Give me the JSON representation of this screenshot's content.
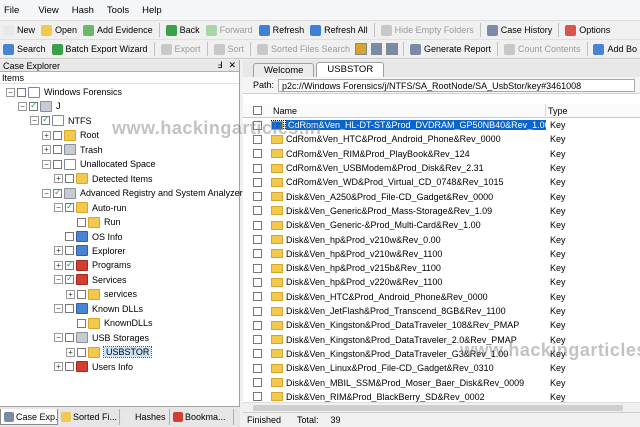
{
  "menubar": [
    "File",
    "View",
    "Hash",
    "Tools",
    "Help"
  ],
  "toolbar1": [
    {
      "label": "New",
      "icon": "new-icon",
      "color": "#e8e8ea",
      "disabled": false
    },
    {
      "label": "Open",
      "icon": "open-folder-icon",
      "color": "#f2c94c",
      "disabled": false
    },
    {
      "label": "Add Evidence",
      "icon": "add-evidence-icon",
      "color": "#6cb86a",
      "disabled": false
    },
    {
      "label": "Back",
      "icon": "back-arrow-icon",
      "color": "#3aa04a",
      "disabled": false
    },
    {
      "label": "Forward",
      "icon": "forward-arrow-icon",
      "color": "#a8d5a8",
      "disabled": true
    },
    {
      "label": "Refresh",
      "icon": "refresh-icon",
      "color": "#3f7fd8",
      "disabled": false
    },
    {
      "label": "Refresh All",
      "icon": "refresh-all-icon",
      "color": "#3f7fd8",
      "disabled": false
    },
    {
      "label": "Hide Empty Folders",
      "icon": "hide-folders-icon",
      "color": "#c8c8c8",
      "disabled": true
    },
    {
      "label": "Case History",
      "icon": "case-history-icon",
      "color": "#7a8aa8",
      "disabled": false
    },
    {
      "label": "Options",
      "icon": "options-gear-icon",
      "color": "#d9534f",
      "disabled": false
    }
  ],
  "toolbar2": [
    {
      "label": "Search",
      "icon": "search-icon",
      "color": "#4a82d4",
      "disabled": false
    },
    {
      "label": "Batch Export Wizard",
      "icon": "batch-export-icon",
      "color": "#3aa04a",
      "disabled": false
    },
    {
      "label": "Export",
      "icon": "export-icon",
      "color": "#c8c8c8",
      "disabled": true
    },
    {
      "label": "Sort",
      "icon": "sort-icon",
      "color": "#c8c8c8",
      "disabled": true
    },
    {
      "label": "Sorted Files Search",
      "icon": "sorted-search-icon",
      "color": "#c8c8c8",
      "disabled": true
    },
    {
      "label": "Generate Report",
      "icon": "report-icon",
      "color": "#7a8aa8",
      "disabled": false
    },
    {
      "label": "Count Contents",
      "icon": "count-contents-icon",
      "color": "#c8c8c8",
      "disabled": true
    },
    {
      "label": "Add Bo",
      "icon": "add-bookmark-icon",
      "color": "#4a82d4",
      "disabled": false
    }
  ],
  "left_pane": {
    "title": "Case Explorer",
    "pin": "Ⅎ",
    "close": "✕",
    "items_label": "Items",
    "tree": [
      {
        "label": "Windows Forensics",
        "level": 0,
        "icon": "case-icon",
        "expander": "−",
        "checkbox": true,
        "checked": false
      },
      {
        "label": "J",
        "level": 1,
        "icon": "drive-icon",
        "expander": "−",
        "checkbox": true,
        "checked": true
      },
      {
        "label": "NTFS",
        "level": 2,
        "icon": "ntfs-icon",
        "expander": "−",
        "checkbox": true,
        "checked": true
      },
      {
        "label": "Root",
        "level": 3,
        "icon": "folder-icon",
        "expander": "+",
        "checkbox": true,
        "checked": false
      },
      {
        "label": "Trash",
        "level": 3,
        "icon": "trash-icon",
        "expander": "+",
        "checkbox": true,
        "checked": false
      },
      {
        "label": "Unallocated Space",
        "level": 3,
        "icon": "unallocated-icon",
        "expander": "−",
        "checkbox": true,
        "checked": false
      },
      {
        "label": "Detected Items",
        "level": 4,
        "icon": "detected-icon",
        "expander": "+",
        "checkbox": true,
        "checked": false
      },
      {
        "label": "Advanced Registry and System Analyzer",
        "level": 3,
        "icon": "registry-icon",
        "expander": "−",
        "checkbox": true,
        "checked": true
      },
      {
        "label": "Auto-run",
        "level": 4,
        "icon": "autorun-icon",
        "expander": "−",
        "checkbox": true,
        "checked": true
      },
      {
        "label": "Run",
        "level": 5,
        "icon": "folder-icon",
        "expander": "",
        "checkbox": true,
        "checked": false
      },
      {
        "label": "OS Info",
        "level": 4,
        "icon": "os-info-icon",
        "expander": "",
        "checkbox": true,
        "checked": false
      },
      {
        "label": "Explorer",
        "level": 4,
        "icon": "explorer-icon",
        "expander": "+",
        "checkbox": true,
        "checked": false
      },
      {
        "label": "Programs",
        "level": 4,
        "icon": "programs-icon",
        "expander": "+",
        "checkbox": true,
        "checked": true
      },
      {
        "label": "Services",
        "level": 4,
        "icon": "services-icon",
        "expander": "−",
        "checkbox": true,
        "checked": true
      },
      {
        "label": "services",
        "level": 5,
        "icon": "folder-icon",
        "expander": "+",
        "checkbox": true,
        "checked": false
      },
      {
        "label": "Known DLLs",
        "level": 4,
        "icon": "known-dlls-icon",
        "expander": "−",
        "checkbox": true,
        "checked": false
      },
      {
        "label": "KnownDLLs",
        "level": 5,
        "icon": "folder-icon",
        "expander": "",
        "checkbox": true,
        "checked": false
      },
      {
        "label": "USB Storages",
        "level": 4,
        "icon": "usb-icon",
        "expander": "−",
        "checkbox": true,
        "checked": false
      },
      {
        "label": "USBSTOR",
        "level": 5,
        "icon": "folder-icon",
        "expander": "+",
        "checkbox": true,
        "checked": false,
        "selected": true
      },
      {
        "label": "Users Info",
        "level": 4,
        "icon": "users-icon",
        "expander": "+",
        "checkbox": true,
        "checked": false
      }
    ]
  },
  "bottom_tabs": [
    {
      "label": "Case Exp...",
      "icon": "case-explorer-icon",
      "active": true
    },
    {
      "label": "Sorted Fi...",
      "icon": "sorted-files-icon",
      "active": false
    },
    {
      "label": "Hashes",
      "icon": "hashes-icon",
      "active": false
    },
    {
      "label": "Bookma...",
      "icon": "bookmarks-icon",
      "active": false
    }
  ],
  "right_pane": {
    "tabs": [
      {
        "label": "Welcome",
        "active": false
      },
      {
        "label": "USBSTOR",
        "active": true
      }
    ],
    "path_label": "Path:",
    "path_value": "p2c://Windows Forensics/j/NTFS/SA_RootNode/SA_UsbStor/key#3461008",
    "columns": {
      "name": "Name",
      "type": "Type"
    },
    "rows": [
      {
        "name": "CdRom&Ven_HL-DT-ST&Prod_DVDRAM_GP50NB40&Rev_1.00",
        "type": "Key",
        "selected": true
      },
      {
        "name": "CdRom&Ven_HTC&Prod_Android_Phone&Rev_0000",
        "type": "Key"
      },
      {
        "name": "CdRom&Ven_RIM&Prod_PlayBook&Rev_124",
        "type": "Key"
      },
      {
        "name": "CdRom&Ven_USBModem&Prod_Disk&Rev_2.31",
        "type": "Key"
      },
      {
        "name": "CdRom&Ven_WD&Prod_Virtual_CD_0748&Rev_1015",
        "type": "Key"
      },
      {
        "name": "Disk&Ven_A250&Prod_File-CD_Gadget&Rev_0000",
        "type": "Key"
      },
      {
        "name": "Disk&Ven_Generic&Prod_Mass-Storage&Rev_1.09",
        "type": "Key"
      },
      {
        "name": "Disk&Ven_Generic-&Prod_Multi-Card&Rev_1.00",
        "type": "Key"
      },
      {
        "name": "Disk&Ven_hp&Prod_v210w&Rev_0.00",
        "type": "Key"
      },
      {
        "name": "Disk&Ven_hp&Prod_v210w&Rev_1100",
        "type": "Key"
      },
      {
        "name": "Disk&Ven_hp&Prod_v215b&Rev_1100",
        "type": "Key"
      },
      {
        "name": "Disk&Ven_hp&Prod_v220w&Rev_1100",
        "type": "Key"
      },
      {
        "name": "Disk&Ven_HTC&Prod_Android_Phone&Rev_0000",
        "type": "Key"
      },
      {
        "name": "Disk&Ven_JetFlash&Prod_Transcend_8GB&Rev_1100",
        "type": "Key"
      },
      {
        "name": "Disk&Ven_Kingston&Prod_DataTraveler_108&Rev_PMAP",
        "type": "Key"
      },
      {
        "name": "Disk&Ven_Kingston&Prod_DataTraveler_2.0&Rev_PMAP",
        "type": "Key"
      },
      {
        "name": "Disk&Ven_Kingston&Prod_DataTraveler_G3&Rev_1.00",
        "type": "Key"
      },
      {
        "name": "Disk&Ven_Linux&Prod_File-CD_Gadget&Rev_0310",
        "type": "Key"
      },
      {
        "name": "Disk&Ven_MBIL_SSM&Prod_Moser_Baer_Disk&Rev_0009",
        "type": "Key"
      },
      {
        "name": "Disk&Ven_RIM&Prod_BlackBerry_SD&Rev_0002",
        "type": "Key"
      }
    ],
    "status": {
      "state": "Finished",
      "total_label": "Total:",
      "total_value": "39"
    }
  },
  "watermark_top": "www.hackingarticles.in",
  "watermark_bottom": "www.hackingarticles.in"
}
